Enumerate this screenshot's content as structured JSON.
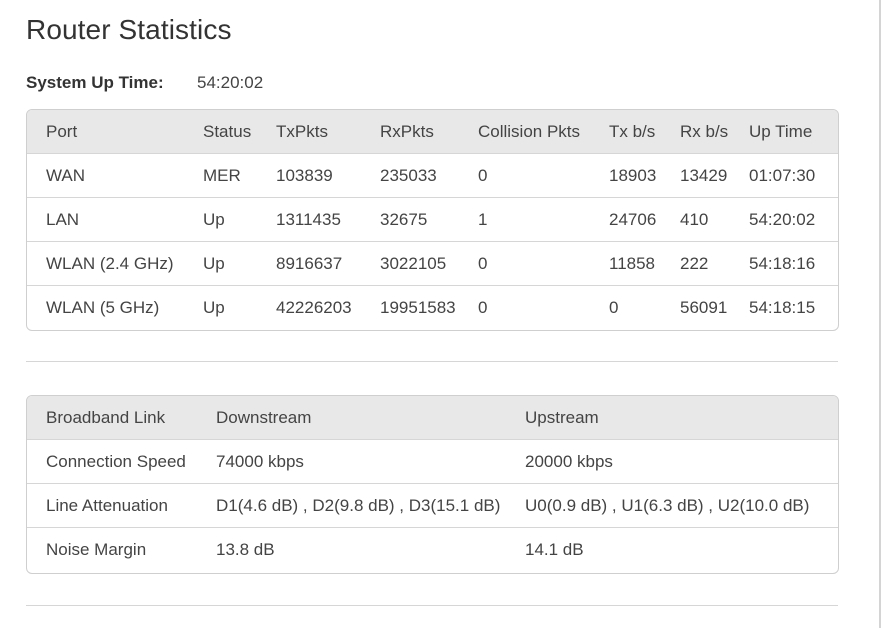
{
  "page": {
    "title": "Router Statistics"
  },
  "uptime": {
    "label": "System Up Time:",
    "value": "54:20:02"
  },
  "ports_table": {
    "headers": [
      "Port",
      "Status",
      "TxPkts",
      "RxPkts",
      "Collision Pkts",
      "Tx b/s",
      "Rx b/s",
      "Up Time"
    ],
    "rows": [
      [
        "WAN",
        "MER",
        "103839",
        "235033",
        "0",
        "18903",
        "13429",
        "01:07:30"
      ],
      [
        "LAN",
        "Up",
        "1311435",
        "32675",
        "1",
        "24706",
        "410",
        "54:20:02"
      ],
      [
        "WLAN (2.4 GHz)",
        "Up",
        "8916637",
        "3022105",
        "0",
        "11858",
        "222",
        "54:18:16"
      ],
      [
        "WLAN (5 GHz)",
        "Up",
        "42226203",
        "19951583",
        "0",
        "0",
        "56091",
        "54:18:15"
      ]
    ]
  },
  "broadband_table": {
    "headers": [
      "Broadband Link",
      "Downstream",
      "Upstream"
    ],
    "rows": [
      [
        "Connection Speed",
        "74000 kbps",
        "20000 kbps"
      ],
      [
        "Line Attenuation",
        "D1(4.6 dB) , D2(9.8 dB) , D3(15.1 dB)",
        "U0(0.9 dB) , U1(6.3 dB) , U2(10.0 dB)"
      ],
      [
        "Noise Margin",
        "13.8 dB",
        "14.1 dB"
      ]
    ]
  }
}
